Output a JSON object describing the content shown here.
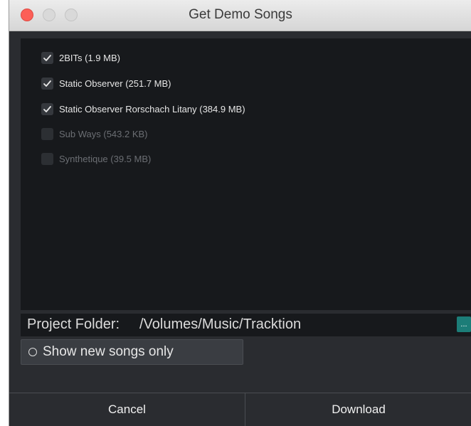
{
  "window": {
    "title": "Get Demo Songs"
  },
  "songs": [
    {
      "label": "2BITs (1.9 MB)",
      "checked": true,
      "enabled": true
    },
    {
      "label": "Static Observer (251.7 MB)",
      "checked": true,
      "enabled": true
    },
    {
      "label": "Static Observer Rorschach Litany (384.9 MB)",
      "checked": true,
      "enabled": true
    },
    {
      "label": "Sub Ways (543.2 KB)",
      "checked": false,
      "enabled": false
    },
    {
      "label": "Synthetique (39.5 MB)",
      "checked": false,
      "enabled": false
    }
  ],
  "project_folder": {
    "label": "Project Folder:",
    "path": "/Volumes/Music/Tracktion",
    "browse_label": "..."
  },
  "options": {
    "show_new_songs_only_label": "Show new songs only",
    "show_new_songs_only": false
  },
  "footer": {
    "cancel_label": "Cancel",
    "download_label": "Download"
  },
  "colors": {
    "accent": "#1c7d78",
    "close_button": "#fc5f57"
  }
}
